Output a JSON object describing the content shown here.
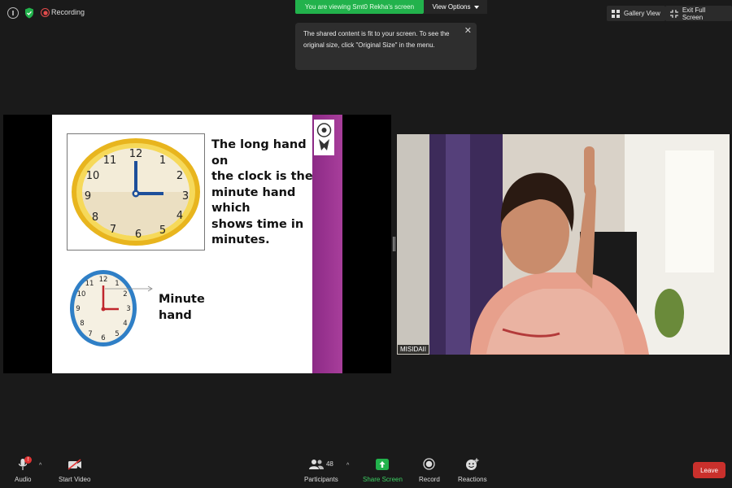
{
  "status": {
    "recording_label": "Recording"
  },
  "banner": {
    "viewing_text": "You are viewing Smt0 Rekha's screen",
    "view_options_label": "View Options"
  },
  "tooltip": {
    "line1": "The shared content is fit to your screen. To see the",
    "line2": "original size, click \"Original Size\" in the menu."
  },
  "top_buttons": {
    "gallery_view": "Gallery View",
    "exit_full_screen": "Exit Full Screen"
  },
  "slide": {
    "text_lines": [
      "The long hand on",
      "the clock is the",
      "minute hand which",
      "shows time in",
      "minutes."
    ],
    "minute_label_line1": "Minute",
    "minute_label_line2": "hand",
    "clock_numbers": [
      "12",
      "1",
      "2",
      "3",
      "4",
      "5",
      "6",
      "7",
      "8",
      "9",
      "10",
      "11"
    ]
  },
  "video": {
    "name_tag": "MISIDAII"
  },
  "toolbar": {
    "audio": "Audio",
    "audio_badge": "!",
    "start_video": "Start Video",
    "participants": "Participants",
    "participants_count": "48",
    "share_screen": "Share Screen",
    "record": "Record",
    "reactions": "Reactions",
    "leave": "Leave"
  },
  "colors": {
    "share_green": "#22b24c",
    "leave_red": "#c9302c",
    "slide_purple": "#a83e9b"
  }
}
